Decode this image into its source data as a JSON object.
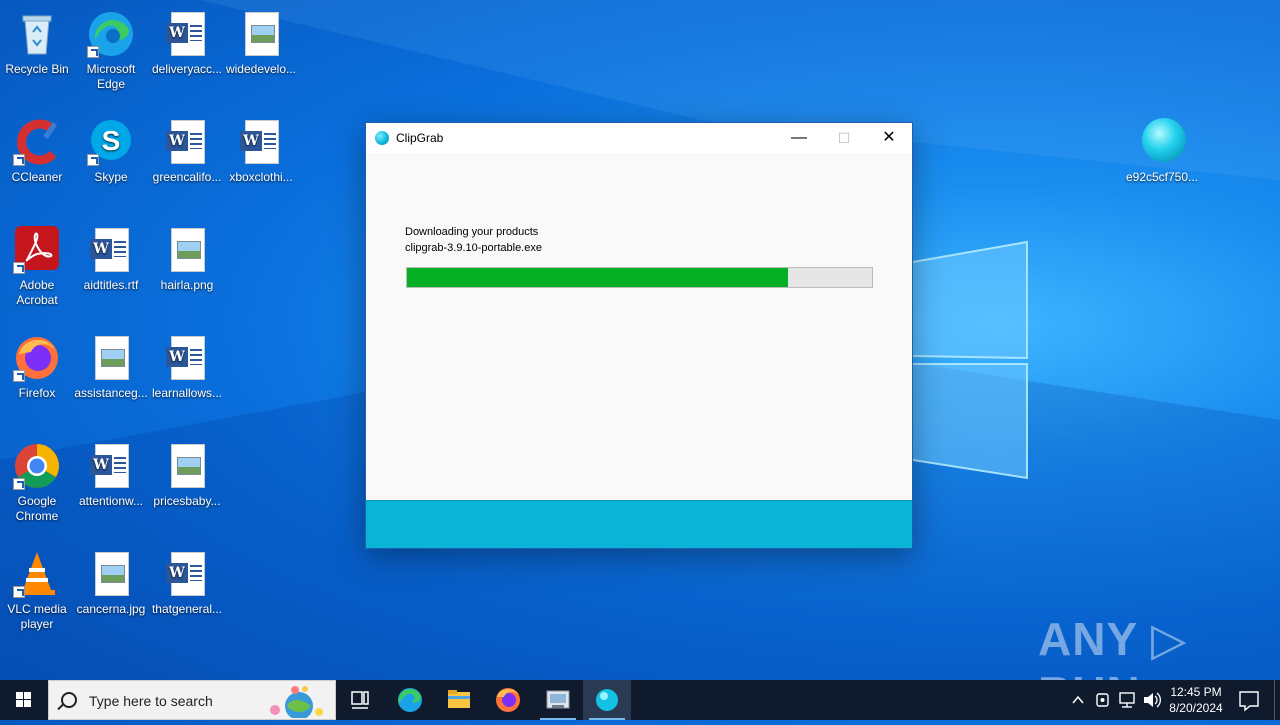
{
  "desktop": {
    "icons": [
      {
        "label": "Recycle Bin"
      },
      {
        "label": "Microsoft Edge"
      },
      {
        "label": "deliveryacc..."
      },
      {
        "label": "widedevelo..."
      },
      {
        "label": "CCleaner"
      },
      {
        "label": "Skype"
      },
      {
        "label": "greencalifo..."
      },
      {
        "label": "xboxclothi..."
      },
      {
        "label": "Adobe Acrobat"
      },
      {
        "label": "aidtitles.rtf"
      },
      {
        "label": "hairla.png"
      },
      {
        "label": "Firefox"
      },
      {
        "label": "assistanceg..."
      },
      {
        "label": "learnallows..."
      },
      {
        "label": "Google Chrome"
      },
      {
        "label": "attentionw..."
      },
      {
        "label": "pricesbaby..."
      },
      {
        "label": "VLC media player"
      },
      {
        "label": "cancerna.jpg"
      },
      {
        "label": "thatgeneral..."
      },
      {
        "label": "e92c5cf750..."
      }
    ]
  },
  "window": {
    "title": "ClipGrab",
    "minimize_glyph": "—",
    "maximize_glyph": "☐",
    "close_glyph": "✕",
    "message_line1": "Downloading your products",
    "message_line2": "clipgrab-3.9.10-portable.exe",
    "progress_fraction": 0.82,
    "progress_color": "#06b025",
    "footer_color": "#0ab4d6"
  },
  "watermark": "ANY ▷ RUN",
  "taskbar": {
    "search_placeholder": "Type here to search",
    "clock_time": "12:45 PM",
    "clock_date": "8/20/2024",
    "apps": [
      "task-view-icon",
      "edge-icon",
      "file-explorer-icon",
      "firefox-icon",
      "installer-icon",
      "clipgrab-icon"
    ]
  }
}
